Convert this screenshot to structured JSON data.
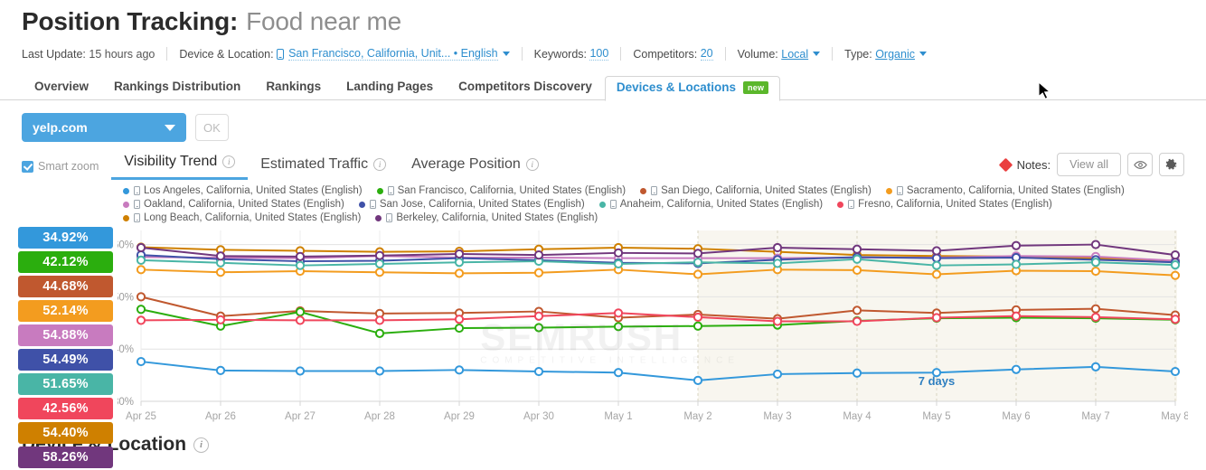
{
  "header": {
    "title_main": "Position Tracking:",
    "title_sub": "Food near me",
    "meta": {
      "last_update_label": "Last Update:",
      "last_update_value": "15 hours ago",
      "device_location_label": "Device & Location:",
      "device_location_value": "San Francisco, California, Unit... • English",
      "keywords_label": "Keywords:",
      "keywords_value": "100",
      "competitors_label": "Competitors:",
      "competitors_value": "20",
      "volume_label": "Volume:",
      "volume_value": "Local",
      "type_label": "Type:",
      "type_value": "Organic"
    }
  },
  "tabs": [
    {
      "label": "Overview",
      "active": false
    },
    {
      "label": "Rankings Distribution",
      "active": false
    },
    {
      "label": "Rankings",
      "active": false
    },
    {
      "label": "Landing Pages",
      "active": false
    },
    {
      "label": "Competitors Discovery",
      "active": false
    },
    {
      "label": "Devices & Locations",
      "active": true,
      "badge": "new"
    }
  ],
  "controls": {
    "domain_value": "yelp.com",
    "ok_label": "OK"
  },
  "chart_tabs": {
    "smart_zoom_label": "Smart zoom",
    "smart_zoom_checked": true,
    "items": [
      {
        "label": "Visibility Trend",
        "active": true
      },
      {
        "label": "Estimated Traffic",
        "active": false
      },
      {
        "label": "Average Position",
        "active": false
      }
    ]
  },
  "notes": {
    "label": "Notes:",
    "view_all_label": "View all",
    "eye_icon": "eye-icon",
    "gear_icon": "gear-icon"
  },
  "watermark": {
    "text": "SEMRUSH",
    "sub": "COMPETITIVE INTELLIGENCE"
  },
  "annotation": {
    "days_label": "7 days"
  },
  "footer": {
    "section_title": "Device & Location"
  },
  "chart_data": {
    "type": "line",
    "title": "Visibility Trend",
    "xlabel": "",
    "ylabel": "",
    "ylim": [
      30,
      62
    ],
    "yticks": [
      30,
      40,
      50,
      60
    ],
    "ytick_labels": [
      "30%",
      "40%",
      "50%",
      "60%"
    ],
    "grid": true,
    "legend_position": "top",
    "highlight_region": {
      "from": "May 2",
      "to": "May 8",
      "label": "7 days",
      "color": "#f2efe2"
    },
    "categories": [
      "Apr 25",
      "Apr 26",
      "Apr 27",
      "Apr 28",
      "Apr 29",
      "Apr 30",
      "May 1",
      "May 2",
      "May 3",
      "May 4",
      "May 5",
      "May 6",
      "May 7",
      "May 8"
    ],
    "series": [
      {
        "name": "Los Angeles, California, United States (English)",
        "color": "#3398db",
        "badge": "34.92%",
        "device": "mobile",
        "values": [
          37.6,
          35.9,
          35.8,
          35.8,
          36.0,
          35.7,
          35.5,
          34.0,
          35.2,
          35.4,
          35.5,
          36.1,
          36.6,
          35.7
        ]
      },
      {
        "name": "San Francisco, California, United States (English)",
        "color": "#2bae0e",
        "badge": "42.12%",
        "device": "mobile",
        "values": [
          47.6,
          44.4,
          47.1,
          43.0,
          44.0,
          44.1,
          44.3,
          44.4,
          44.6,
          45.4,
          45.9,
          46.0,
          45.9,
          45.6
        ]
      },
      {
        "name": "San Diego, California, United States (English)",
        "color": "#c0582f",
        "badge": "44.68%",
        "device": "mobile",
        "values": [
          50.0,
          46.3,
          47.3,
          46.8,
          46.9,
          47.2,
          46.0,
          46.6,
          45.8,
          47.4,
          46.9,
          47.5,
          47.7,
          46.5
        ]
      },
      {
        "name": "Sacramento, California, United States (English)",
        "color": "#f39c1f",
        "badge": "52.14%",
        "device": "mobile",
        "values": [
          55.2,
          54.7,
          54.9,
          54.7,
          54.5,
          54.6,
          55.2,
          54.3,
          55.2,
          55.1,
          54.3,
          55.0,
          54.9,
          54.1
        ]
      },
      {
        "name": "Oakland, California, United States (English)",
        "color": "#c87bbf",
        "badge": "54.88%",
        "device": "mobile",
        "values": [
          57.6,
          57.5,
          57.4,
          57.8,
          57.5,
          57.5,
          57.4,
          57.4,
          57.4,
          57.5,
          57.5,
          57.8,
          57.7,
          56.9
        ]
      },
      {
        "name": "San Jose, California, United States (English)",
        "color": "#3f51a8",
        "badge": "54.49%",
        "device": "mobile",
        "values": [
          58.0,
          57.2,
          56.8,
          56.9,
          57.4,
          57.0,
          56.5,
          56.4,
          57.1,
          57.6,
          57.4,
          57.5,
          57.1,
          56.6
        ]
      },
      {
        "name": "Anaheim, California, United States (English)",
        "color": "#49b5a6",
        "badge": "51.65%",
        "device": "mobile",
        "values": [
          57.0,
          56.5,
          56.0,
          56.3,
          56.6,
          56.8,
          56.3,
          56.6,
          56.4,
          57.2,
          56.0,
          56.2,
          56.6,
          56.1
        ]
      },
      {
        "name": "Fresno, California, United States (English)",
        "color": "#f0465c",
        "badge": "42.56%",
        "device": "mobile",
        "values": [
          45.5,
          45.6,
          45.5,
          45.5,
          45.7,
          46.3,
          46.9,
          46.1,
          45.3,
          45.3,
          46.0,
          46.3,
          46.1,
          45.7
        ]
      },
      {
        "name": "Long Beach, California, United States (English)",
        "color": "#cf8000",
        "badge": "54.40%",
        "device": "mobile",
        "values": [
          59.5,
          59.0,
          58.8,
          58.6,
          58.7,
          59.1,
          59.4,
          59.2,
          58.6,
          58.0,
          57.8,
          57.7,
          57.4,
          56.9
        ]
      },
      {
        "name": "Berkeley, California, United States (English)",
        "color": "#71377d",
        "badge": "58.26%",
        "device": "mobile",
        "values": [
          59.4,
          57.8,
          57.7,
          57.9,
          58.2,
          58.0,
          58.4,
          58.3,
          59.4,
          59.1,
          58.8,
          59.8,
          60.0,
          58.0
        ]
      }
    ]
  }
}
